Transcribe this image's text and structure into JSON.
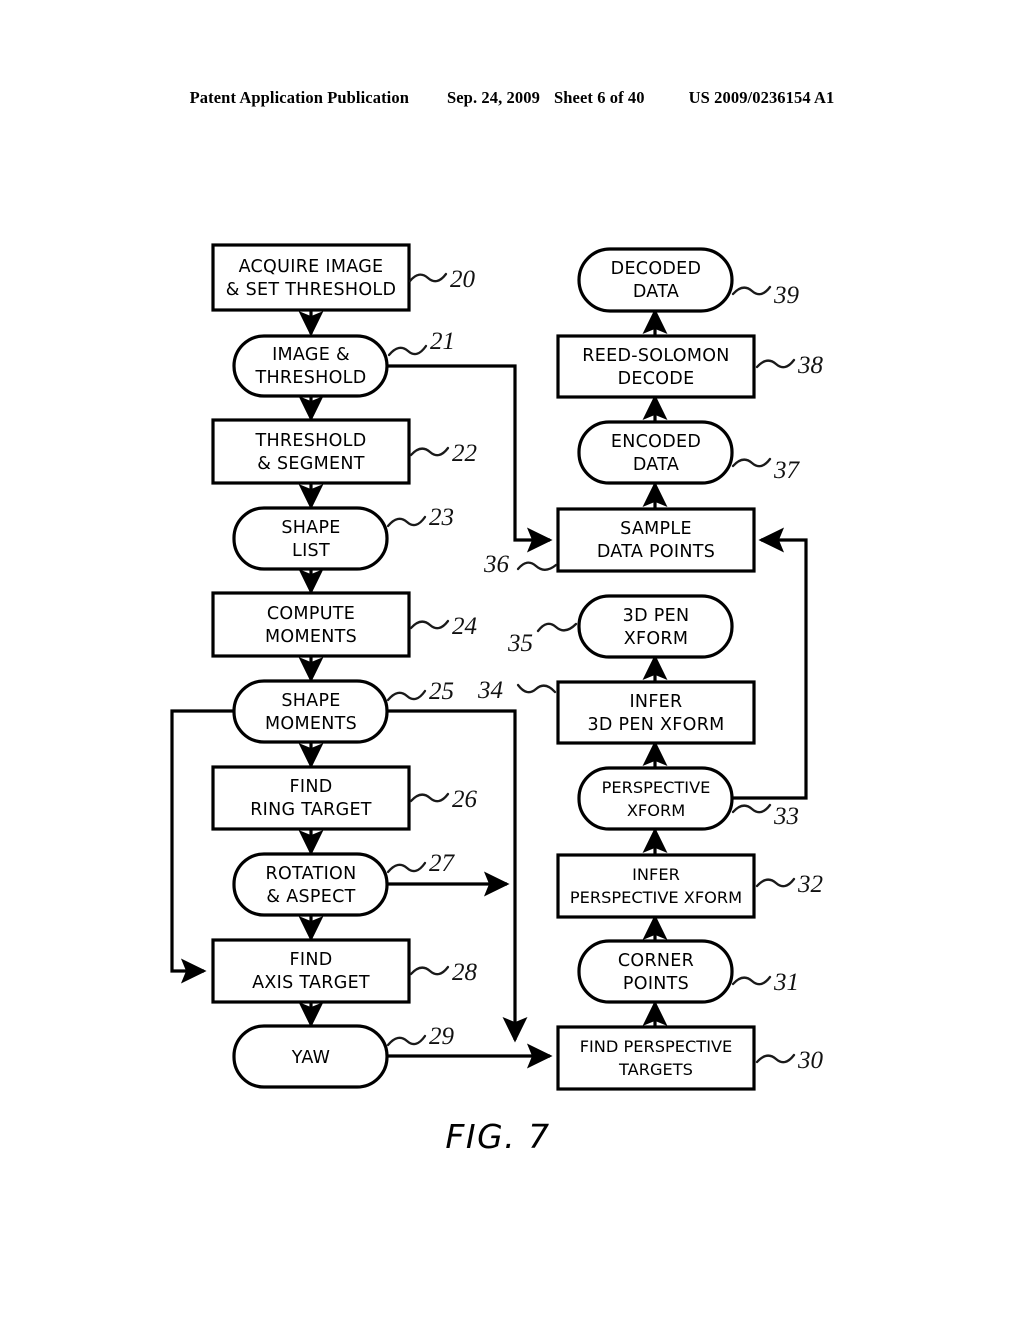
{
  "header": {
    "publication": "Patent Application Publication",
    "date": "Sep. 24, 2009",
    "sheet": "Sheet 6 of 40",
    "number": "US 2009/0236154 A1"
  },
  "figure": {
    "label": "FIG. 7",
    "caption": "FIG. 7"
  },
  "nodes": [
    {
      "ref": "20",
      "shape": "rect",
      "lines": [
        "ACQUIRE IMAGE",
        "& SET THRESHOLD"
      ]
    },
    {
      "ref": "21",
      "shape": "stadium",
      "lines": [
        "IMAGE &",
        "THRESHOLD"
      ]
    },
    {
      "ref": "22",
      "shape": "rect",
      "lines": [
        "THRESHOLD",
        "& SEGMENT"
      ]
    },
    {
      "ref": "23",
      "shape": "stadium",
      "lines": [
        "SHAPE",
        "LIST"
      ]
    },
    {
      "ref": "24",
      "shape": "rect",
      "lines": [
        "COMPUTE",
        "MOMENTS"
      ]
    },
    {
      "ref": "25",
      "shape": "stadium",
      "lines": [
        "SHAPE",
        "MOMENTS"
      ]
    },
    {
      "ref": "26",
      "shape": "rect",
      "lines": [
        "FIND",
        "RING TARGET"
      ]
    },
    {
      "ref": "27",
      "shape": "stadium",
      "lines": [
        "ROTATION",
        "& ASPECT"
      ]
    },
    {
      "ref": "28",
      "shape": "rect",
      "lines": [
        "FIND",
        "AXIS TARGET"
      ]
    },
    {
      "ref": "29",
      "shape": "stadium",
      "lines": [
        "YAW"
      ]
    },
    {
      "ref": "30",
      "shape": "rect",
      "lines": [
        "FIND PERSPECTIVE",
        "TARGETS"
      ]
    },
    {
      "ref": "31",
      "shape": "stadium",
      "lines": [
        "CORNER",
        "POINTS"
      ]
    },
    {
      "ref": "32",
      "shape": "rect",
      "lines": [
        "INFER",
        "PERSPECTIVE XFORM"
      ]
    },
    {
      "ref": "33",
      "shape": "stadium",
      "lines": [
        "PERSPECTIVE",
        "XFORM"
      ]
    },
    {
      "ref": "34",
      "shape": "rect",
      "lines": [
        "INFER",
        "3D PEN XFORM"
      ]
    },
    {
      "ref": "35",
      "shape": "stadium",
      "lines": [
        "3D PEN",
        "XFORM"
      ]
    },
    {
      "ref": "36",
      "shape": "rect",
      "lines": [
        "SAMPLE",
        "DATA POINTS"
      ]
    },
    {
      "ref": "37",
      "shape": "stadium",
      "lines": [
        "ENCODED",
        "DATA"
      ]
    },
    {
      "ref": "38",
      "shape": "rect",
      "lines": [
        "REED-SOLOMON",
        "DECODE"
      ]
    },
    {
      "ref": "39",
      "shape": "stadium",
      "lines": [
        "DECODED",
        "DATA"
      ]
    }
  ],
  "ref_numbers": [
    "20",
    "21",
    "22",
    "23",
    "24",
    "25",
    "26",
    "27",
    "28",
    "29",
    "30",
    "31",
    "32",
    "33",
    "34",
    "35",
    "36",
    "37",
    "38",
    "39"
  ],
  "colors": {
    "ink": "#000000",
    "paper": "#ffffff"
  }
}
